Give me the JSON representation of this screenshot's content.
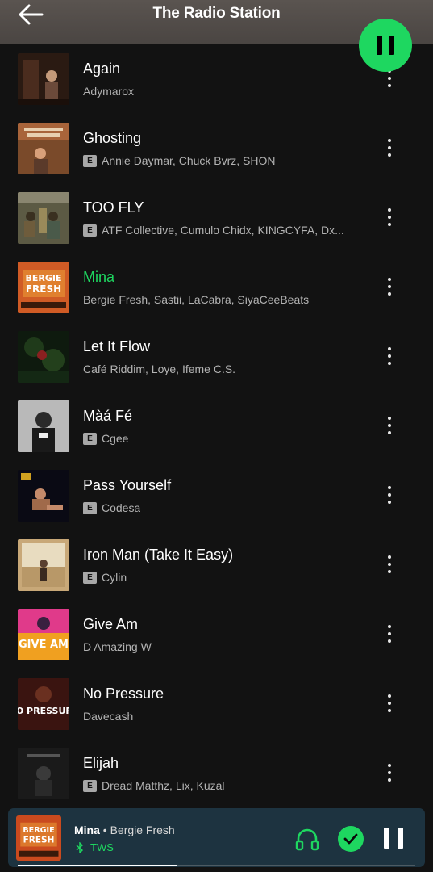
{
  "header": {
    "title": "The Radio Station"
  },
  "tracks": [
    {
      "title": "Again",
      "artists": "Adymarox",
      "explicit": false,
      "active": false
    },
    {
      "title": "Ghosting",
      "artists": "Annie Daymar, Chuck Bvrz, SHON",
      "explicit": true,
      "active": false
    },
    {
      "title": "TOO FLY",
      "artists": "ATF Collective, Cumulo Chidx, KINGCYFA, Dx...",
      "explicit": true,
      "active": false
    },
    {
      "title": "Mina",
      "artists": "Bergie Fresh, Sastii, LaCabra, SiyaCeeBeats",
      "explicit": false,
      "active": true
    },
    {
      "title": "Let It Flow",
      "artists": "Café Riddim, Loye, Ifeme C.S.",
      "explicit": false,
      "active": false
    },
    {
      "title": "Màá Fé",
      "artists": "Cgee",
      "explicit": true,
      "active": false
    },
    {
      "title": "Pass Yourself",
      "artists": "Codesa",
      "explicit": true,
      "active": false
    },
    {
      "title": "Iron Man (Take It Easy)",
      "artists": "Cylin",
      "explicit": true,
      "active": false
    },
    {
      "title": "Give Am",
      "artists": "D Amazing W",
      "explicit": false,
      "active": false
    },
    {
      "title": "No Pressure",
      "artists": "Davecash",
      "explicit": false,
      "active": false
    },
    {
      "title": "Elijah",
      "artists": "Dread Matthz, Lix, Kuzal",
      "explicit": true,
      "active": false
    }
  ],
  "explicit_label": "E",
  "now_playing": {
    "title": "Mina",
    "separator": " • ",
    "artist": "Bergie Fresh",
    "device": "TWS",
    "progress": 0.4
  },
  "cover_text": {
    "bergie_line1": "BERGIE",
    "bergie_line2": "FRESH",
    "give_am": "GIVE AM",
    "no_pressure": "NO PRESSURE"
  },
  "colors": {
    "accent": "#1ed760",
    "background": "#121212",
    "mini_player": "#1d3340"
  },
  "icons": {
    "back": "arrow-left-icon",
    "play_pause": "pause-icon",
    "more": "more-vertical-icon",
    "headphones": "headphones-icon",
    "saved": "check-circle-icon",
    "bluetooth": "bluetooth-icon"
  }
}
